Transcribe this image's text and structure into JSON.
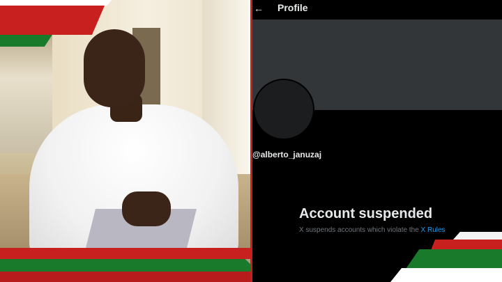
{
  "header": {
    "title": "Profile",
    "back_icon": "arrow-left-icon"
  },
  "profile": {
    "handle": "@alberto_januzaj"
  },
  "notice": {
    "title": "Account suspended",
    "text": "X suspends accounts which violate the ",
    "link": "X Rules"
  },
  "colors": {
    "flag_red": "#c8201e",
    "flag_green": "#1a7a2c",
    "banner": "#333639",
    "link": "#1d9bf0",
    "muted": "#71767b"
  }
}
